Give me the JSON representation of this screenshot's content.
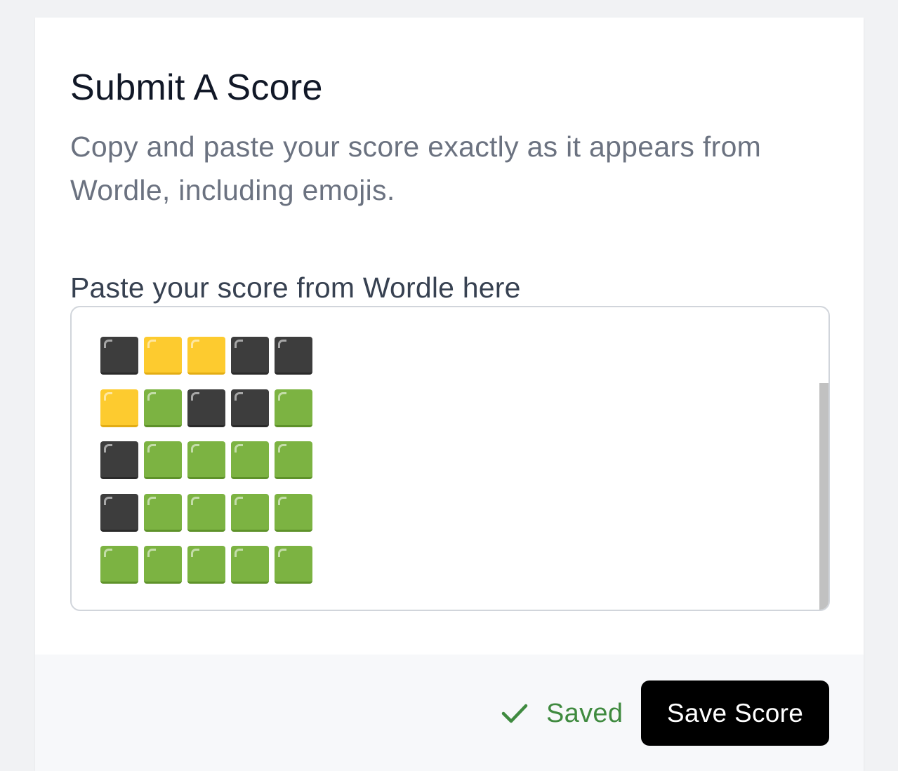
{
  "form": {
    "title": "Submit A Score",
    "description": "Copy and paste your score exactly as it appears from Wordle, including emojis.",
    "field_label": "Paste your score from Wordle here",
    "score_grid": [
      [
        "black",
        "yellow",
        "yellow",
        "black",
        "black"
      ],
      [
        "yellow",
        "green",
        "black",
        "black",
        "green"
      ],
      [
        "black",
        "green",
        "green",
        "green",
        "green"
      ],
      [
        "black",
        "green",
        "green",
        "green",
        "green"
      ],
      [
        "green",
        "green",
        "green",
        "green",
        "green"
      ]
    ]
  },
  "footer": {
    "status_text": "Saved",
    "status_icon": "check-icon",
    "save_label": "Save Score"
  },
  "colors": {
    "black_square": "#3d3d3d",
    "yellow_square": "#fdcb2f",
    "green_square": "#7cb342",
    "status_green": "#3f8a3f",
    "button_bg": "#000000"
  }
}
